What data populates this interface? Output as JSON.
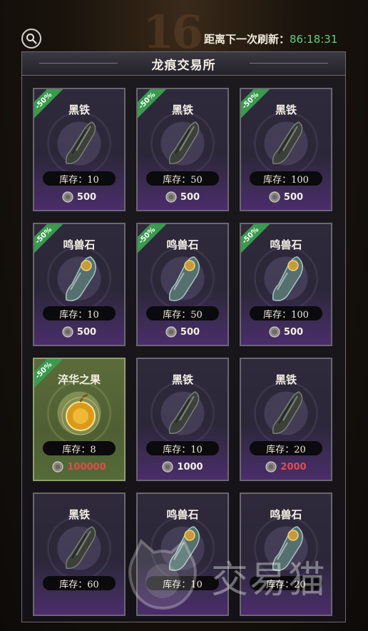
{
  "header": {
    "refresh_label": "距离下一次刷新：",
    "refresh_timer": "86:18:31"
  },
  "panel": {
    "title": "龙痕交易所"
  },
  "discount_label": "-50%",
  "items": [
    {
      "name": "黑铁",
      "stock": "库存：10",
      "price": "500",
      "type": "iron",
      "discount": true,
      "green": false,
      "red": false
    },
    {
      "name": "黑铁",
      "stock": "库存：50",
      "price": "500",
      "type": "iron",
      "discount": true,
      "green": false,
      "red": false
    },
    {
      "name": "黑铁",
      "stock": "库存：100",
      "price": "500",
      "type": "iron",
      "discount": true,
      "green": false,
      "red": false
    },
    {
      "name": "鸣兽石",
      "stock": "库存：10",
      "price": "500",
      "type": "stone",
      "discount": true,
      "green": false,
      "red": false
    },
    {
      "name": "鸣兽石",
      "stock": "库存：50",
      "price": "500",
      "type": "stone",
      "discount": true,
      "green": false,
      "red": false
    },
    {
      "name": "鸣兽石",
      "stock": "库存：100",
      "price": "500",
      "type": "stone",
      "discount": true,
      "green": false,
      "red": false
    },
    {
      "name": "淬华之果",
      "stock": "库存：8",
      "price": "100000",
      "type": "fruit",
      "discount": true,
      "green": true,
      "red": true
    },
    {
      "name": "黑铁",
      "stock": "库存：10",
      "price": "1000",
      "type": "iron",
      "discount": false,
      "green": false,
      "red": false
    },
    {
      "name": "黑铁",
      "stock": "库存：20",
      "price": "2000",
      "type": "iron",
      "discount": false,
      "green": false,
      "red": true
    },
    {
      "name": "黑铁",
      "stock": "库存：60",
      "price": "",
      "type": "iron",
      "discount": false,
      "green": false,
      "red": false
    },
    {
      "name": "鸣兽石",
      "stock": "库存：10",
      "price": "",
      "type": "stone",
      "discount": false,
      "green": false,
      "red": false
    },
    {
      "name": "鸣兽石",
      "stock": "库存：20",
      "price": "",
      "type": "stone",
      "discount": false,
      "green": false,
      "red": false
    }
  ],
  "watermark": {
    "text": "交易猫"
  },
  "colors": {
    "timer": "#5fd17a",
    "discount": "#3a9a4e",
    "price_red": "#e24b4b"
  }
}
